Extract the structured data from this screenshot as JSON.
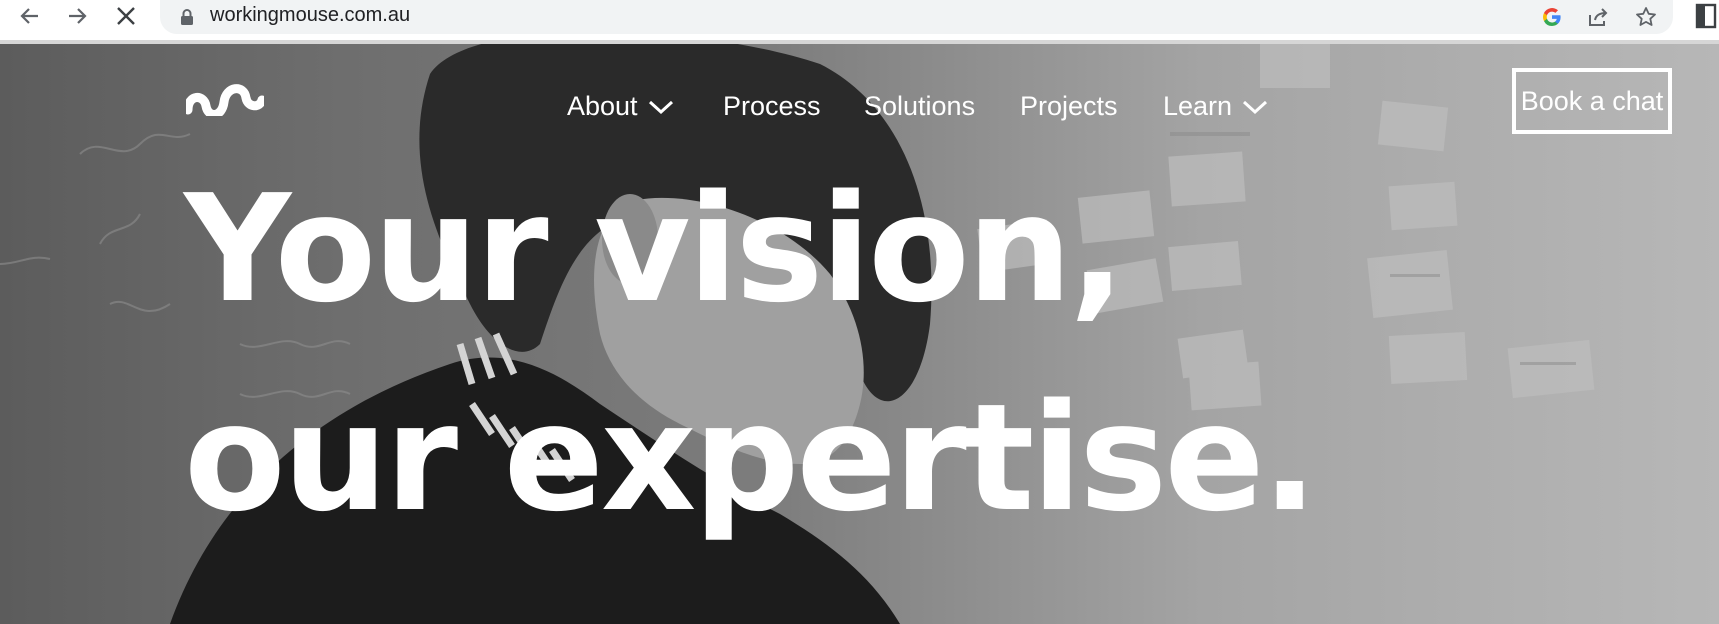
{
  "browser": {
    "url": "workingmouse.com.au"
  },
  "site": {
    "nav": {
      "about": "About",
      "process": "Process",
      "solutions": "Solutions",
      "projects": "Projects",
      "learn": "Learn"
    },
    "cta_label": "Book a chat",
    "headline_line1": "Your vision,",
    "headline_line2": "our expertise."
  },
  "icons": {
    "back": "back-arrow-icon",
    "forward": "forward-arrow-icon",
    "stop": "stop-loading-icon",
    "lock": "lock-icon",
    "google": "google-icon",
    "share": "share-icon",
    "star": "bookmark-star-icon",
    "sidepanel": "side-panel-icon",
    "logo": "working-mouse-logo",
    "chevron": "chevron-down-icon"
  },
  "colors": {
    "nav_text": "#ffffff",
    "omnibox_bg": "#f1f3f4"
  }
}
